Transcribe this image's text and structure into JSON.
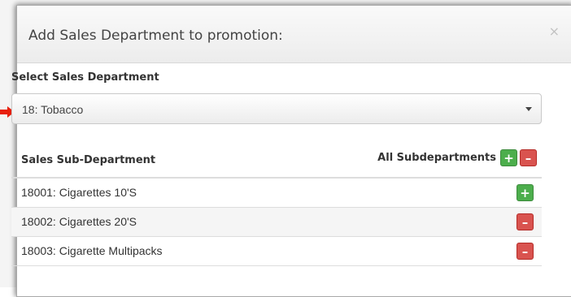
{
  "modal": {
    "title": "Add Sales Department to promotion:",
    "close_glyph": "×"
  },
  "department": {
    "label": "Select Sales Department",
    "selected": "18: Tobacco"
  },
  "table": {
    "column_header": "Sales Sub-Department",
    "all_label": "All Subdepartments",
    "add_glyph": "+",
    "remove_glyph": "–",
    "rows": [
      {
        "label": "18001: Cigarettes 10'S",
        "action": "add"
      },
      {
        "label": "18002: Cigarettes 20'S",
        "action": "remove"
      },
      {
        "label": "18003: Cigarette Multipacks",
        "action": "remove"
      }
    ]
  },
  "colors": {
    "add": "#4cae4c",
    "remove": "#d9534f",
    "pointer_arrow": "#e8200c"
  },
  "icons": {
    "pointer": "arrow-right-icon",
    "close": "close-icon",
    "dropdown": "caret-down-icon",
    "add": "plus-icon",
    "remove": "minus-icon"
  }
}
